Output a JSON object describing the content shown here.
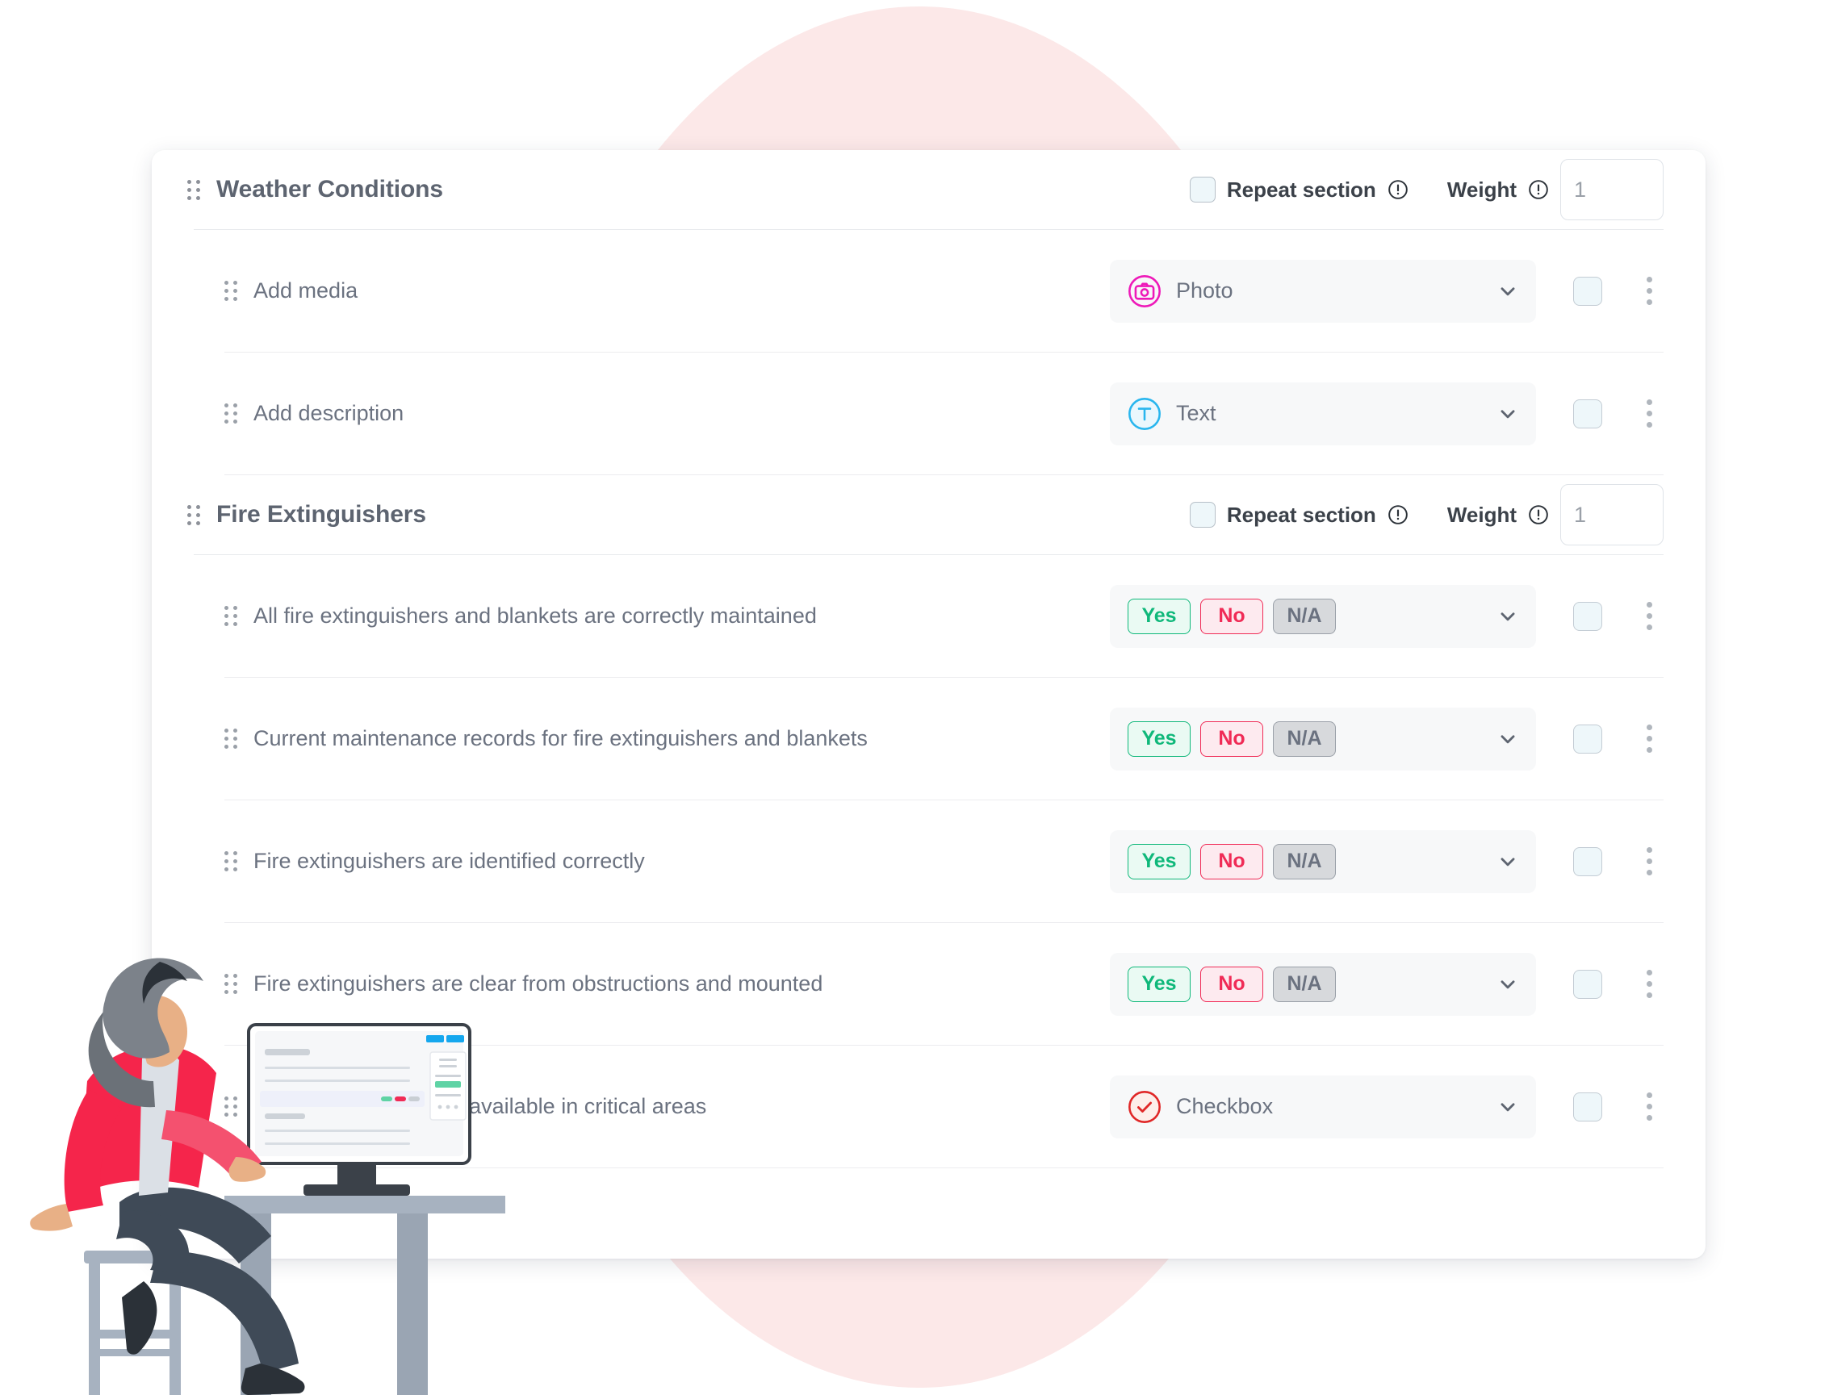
{
  "theme": {
    "accent_pink": "#fce8e8",
    "yes_green": "#0fb87a",
    "no_red": "#f02b56",
    "na_gray": "#6b7280",
    "photo_magenta": "#ee19b9",
    "text_cyan": "#29b6ee",
    "checkbox_red": "#e02727",
    "card_bg": "#ffffff"
  },
  "common": {
    "repeat_section_label": "Repeat section",
    "weight_label": "Weight",
    "info_icon": "info-circle-icon",
    "drag_handle_icon": "drag-handle-icon",
    "kebab_icon": "more-vertical-icon",
    "caret_icon": "chevron-down-icon",
    "row_checkbox_icon": "required-checkbox"
  },
  "sections": [
    {
      "title": "Weather Conditions",
      "repeat_section": {
        "label": "Repeat section",
        "checked": false
      },
      "weight": {
        "label": "Weight",
        "value": "1"
      },
      "questions": [
        {
          "text": "Add media",
          "answer_kind": "type",
          "type_label": "Photo",
          "type_icon": "camera-icon",
          "required_checked": false
        },
        {
          "text": "Add description",
          "answer_kind": "type",
          "type_label": "Text",
          "type_icon": "text-t-icon",
          "required_checked": false
        }
      ]
    },
    {
      "title": "Fire Extinguishers",
      "repeat_section": {
        "label": "Repeat section",
        "checked": false
      },
      "weight": {
        "label": "Weight",
        "value": "1"
      },
      "questions": [
        {
          "text": "All fire extinguishers and blankets are correctly maintained",
          "answer_kind": "pills",
          "pills": [
            "Yes",
            "No",
            "N/A"
          ],
          "required_checked": false
        },
        {
          "text": "Current maintenance records for fire extinguishers and blankets",
          "answer_kind": "pills",
          "pills": [
            "Yes",
            "No",
            "N/A"
          ],
          "required_checked": false
        },
        {
          "text": "Fire extinguishers are identified correctly",
          "answer_kind": "pills",
          "pills": [
            "Yes",
            "No",
            "N/A"
          ],
          "required_checked": false
        },
        {
          "text": "Fire extinguishers are clear from obstructions and mounted",
          "answer_kind": "pills",
          "pills": [
            "Yes",
            "No",
            "N/A"
          ],
          "required_checked": false
        },
        {
          "text": "Fire extinguishers are available in critical areas",
          "answer_kind": "type",
          "type_label": "Checkbox",
          "type_icon": "check-circle-icon",
          "required_checked": false
        }
      ]
    }
  ],
  "illustration": {
    "name": "woman-at-desk-illustration",
    "alt": "Woman wearing hijab seated on a stool pointing at a desktop monitor"
  }
}
